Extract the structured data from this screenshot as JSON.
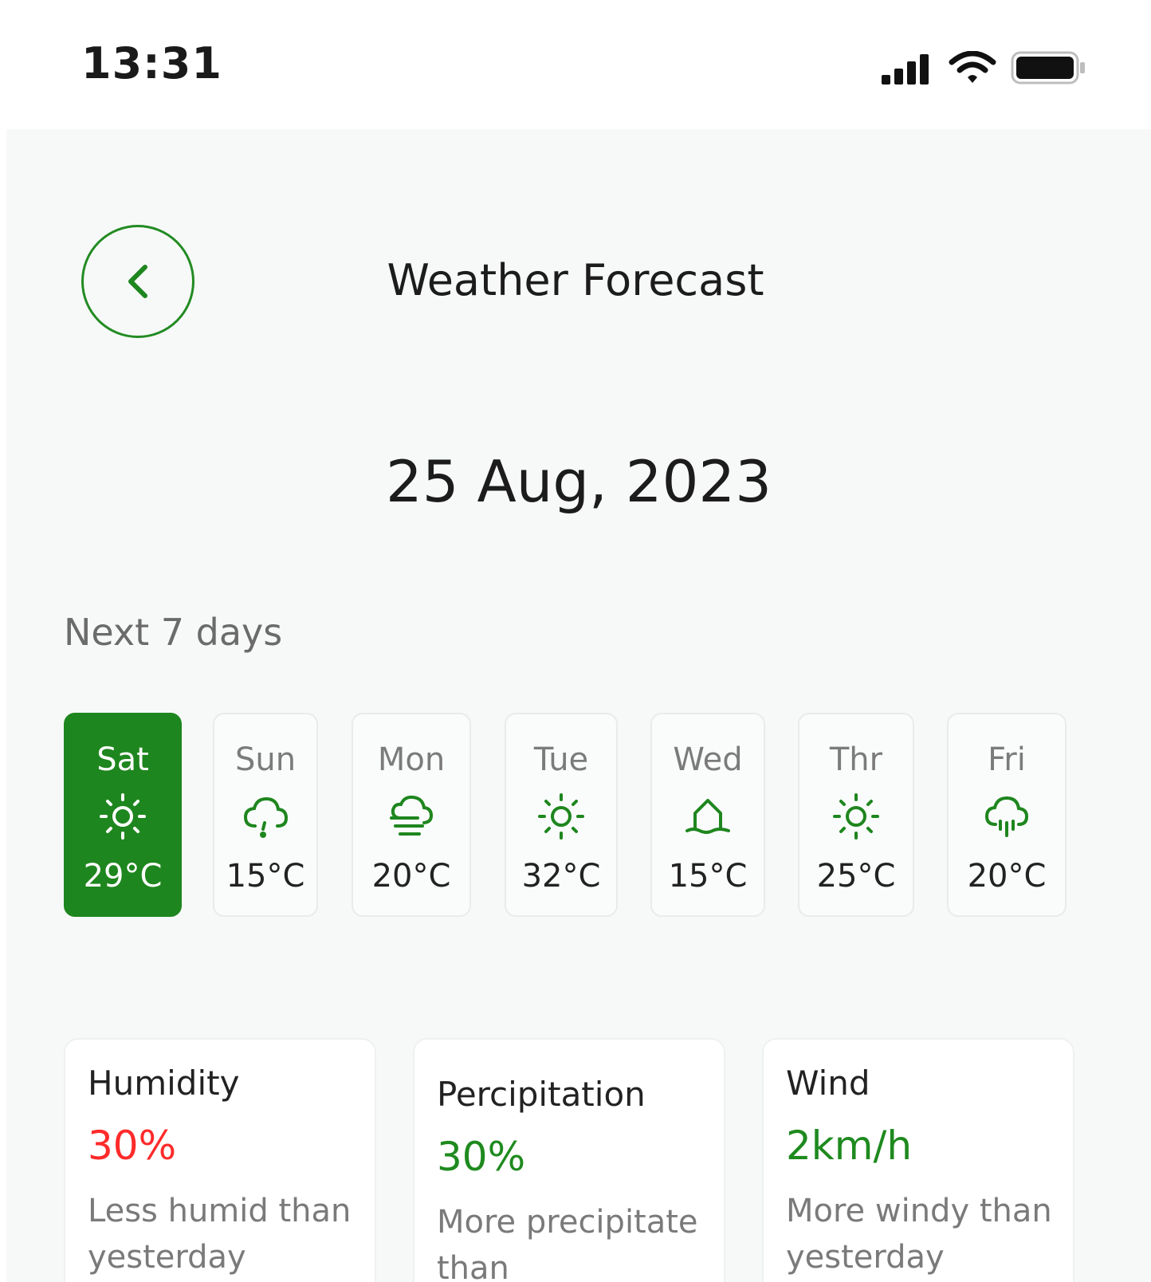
{
  "status_bar": {
    "time": "13:31"
  },
  "header": {
    "title": "Weather Forecast",
    "date": "25 Aug, 2023"
  },
  "forecast": {
    "section_label": "Next 7 days",
    "days": [
      {
        "day": "Sat",
        "temp": "29°C",
        "icon": "sun-icon",
        "selected": true
      },
      {
        "day": "Sun",
        "temp": "15°C",
        "icon": "cloud-drizzle-icon",
        "selected": false
      },
      {
        "day": "Mon",
        "temp": "20°C",
        "icon": "cloud-fog-icon",
        "selected": false
      },
      {
        "day": "Tue",
        "temp": "32°C",
        "icon": "sun-icon",
        "selected": false
      },
      {
        "day": "Wed",
        "temp": "15°C",
        "icon": "sunset-icon",
        "selected": false
      },
      {
        "day": "Thr",
        "temp": "25°C",
        "icon": "sun-icon",
        "selected": false
      },
      {
        "day": "Fri",
        "temp": "20°C",
        "icon": "cloud-rain-icon",
        "selected": false
      }
    ]
  },
  "stats": {
    "humidity": {
      "title": "Humidity",
      "value": "30%",
      "desc": "Less humid than yesterday",
      "color": "#ff2a2a"
    },
    "precipitation": {
      "title": "Percipitation",
      "value": "30%",
      "desc": "More precipitate than",
      "color": "#1e8a1e"
    },
    "wind": {
      "title": "Wind",
      "value": "2km/h",
      "desc": "More windy than yesterday",
      "color": "#1e8a1e"
    }
  },
  "colors": {
    "accent": "#1e861e",
    "negative": "#ff2a2a"
  }
}
